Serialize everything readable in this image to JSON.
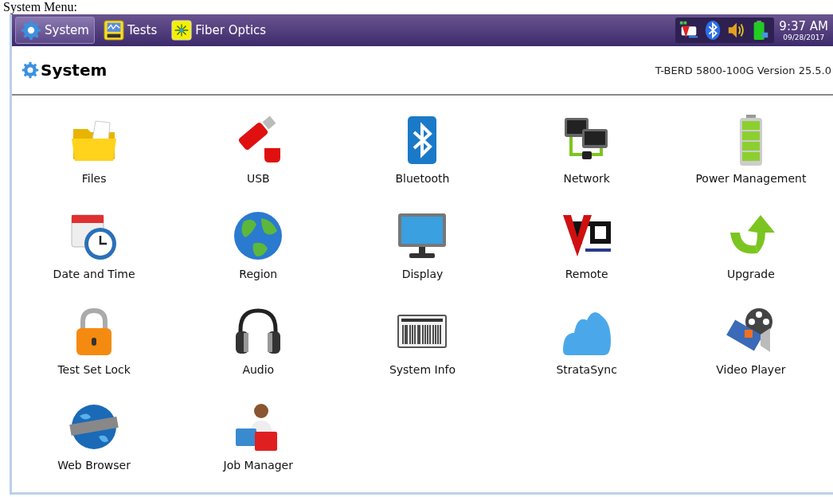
{
  "doc_caption": "System Menu:",
  "tabs": [
    {
      "label": "System",
      "selected": true
    },
    {
      "label": "Tests",
      "selected": false
    },
    {
      "label": "Fiber Optics",
      "selected": false
    }
  ],
  "status": {
    "time": "9:37 AM",
    "date": "09/28/2017"
  },
  "header": {
    "title": "System",
    "version": "T-BERD 5800-100G Version 25.5.0"
  },
  "apps": [
    {
      "label": "Files"
    },
    {
      "label": "USB"
    },
    {
      "label": "Bluetooth"
    },
    {
      "label": "Network"
    },
    {
      "label": "Power Management"
    },
    {
      "label": "Date and Time"
    },
    {
      "label": "Region"
    },
    {
      "label": "Display"
    },
    {
      "label": "Remote"
    },
    {
      "label": "Upgrade"
    },
    {
      "label": "Test Set Lock"
    },
    {
      "label": "Audio"
    },
    {
      "label": "System Info"
    },
    {
      "label": "StrataSync"
    },
    {
      "label": "Video Player"
    },
    {
      "label": "Web Browser"
    },
    {
      "label": "Job Manager"
    }
  ]
}
